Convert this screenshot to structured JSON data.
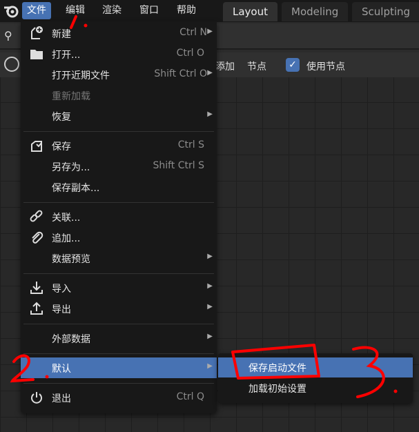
{
  "topbar": {
    "menus": [
      {
        "label": "文件",
        "active": true
      },
      {
        "label": "编辑"
      },
      {
        "label": "渲染"
      },
      {
        "label": "窗口"
      },
      {
        "label": "帮助"
      }
    ],
    "workspaces": [
      {
        "label": "Layout",
        "active": true
      },
      {
        "label": "Modeling"
      },
      {
        "label": "Sculpting"
      }
    ]
  },
  "header": {
    "items": [
      "添加",
      "节点"
    ],
    "use_nodes_label": "使用节点",
    "use_nodes_checked": true
  },
  "file_menu": {
    "items": [
      {
        "label": "新建",
        "shortcut": "Ctrl N",
        "submenu": true,
        "icon": "new-file-icon"
      },
      {
        "label": "打开...",
        "shortcut": "Ctrl O",
        "icon": "folder-icon"
      },
      {
        "label": "打开近期文件",
        "shortcut": "Shift Ctrl O",
        "submenu": true
      },
      {
        "label": "重新加载",
        "disabled": true
      },
      {
        "label": "恢复",
        "submenu": true
      },
      {
        "label": "保存",
        "shortcut": "Ctrl S",
        "icon": "save-icon"
      },
      {
        "label": "另存为...",
        "shortcut": "Shift Ctrl S"
      },
      {
        "label": "保存副本..."
      },
      {
        "label": "关联...",
        "icon": "link-icon"
      },
      {
        "label": "追加...",
        "icon": "paperclip-icon"
      },
      {
        "label": "数据预览",
        "submenu": true
      },
      {
        "label": "导入",
        "submenu": true,
        "icon": "import-icon"
      },
      {
        "label": "导出",
        "submenu": true,
        "icon": "export-icon"
      },
      {
        "label": "外部数据",
        "submenu": true
      },
      {
        "label": "默认",
        "submenu": true,
        "highlighted": true
      },
      {
        "label": "退出",
        "shortcut": "Ctrl Q",
        "icon": "power-icon"
      }
    ]
  },
  "defaults_submenu": {
    "items": [
      {
        "label": "保存启动文件",
        "highlighted": true
      },
      {
        "label": "加载初始设置"
      }
    ]
  },
  "colors": {
    "accent": "#4772b3",
    "annotation": "#ff0000",
    "menu_bg": "#181818"
  }
}
